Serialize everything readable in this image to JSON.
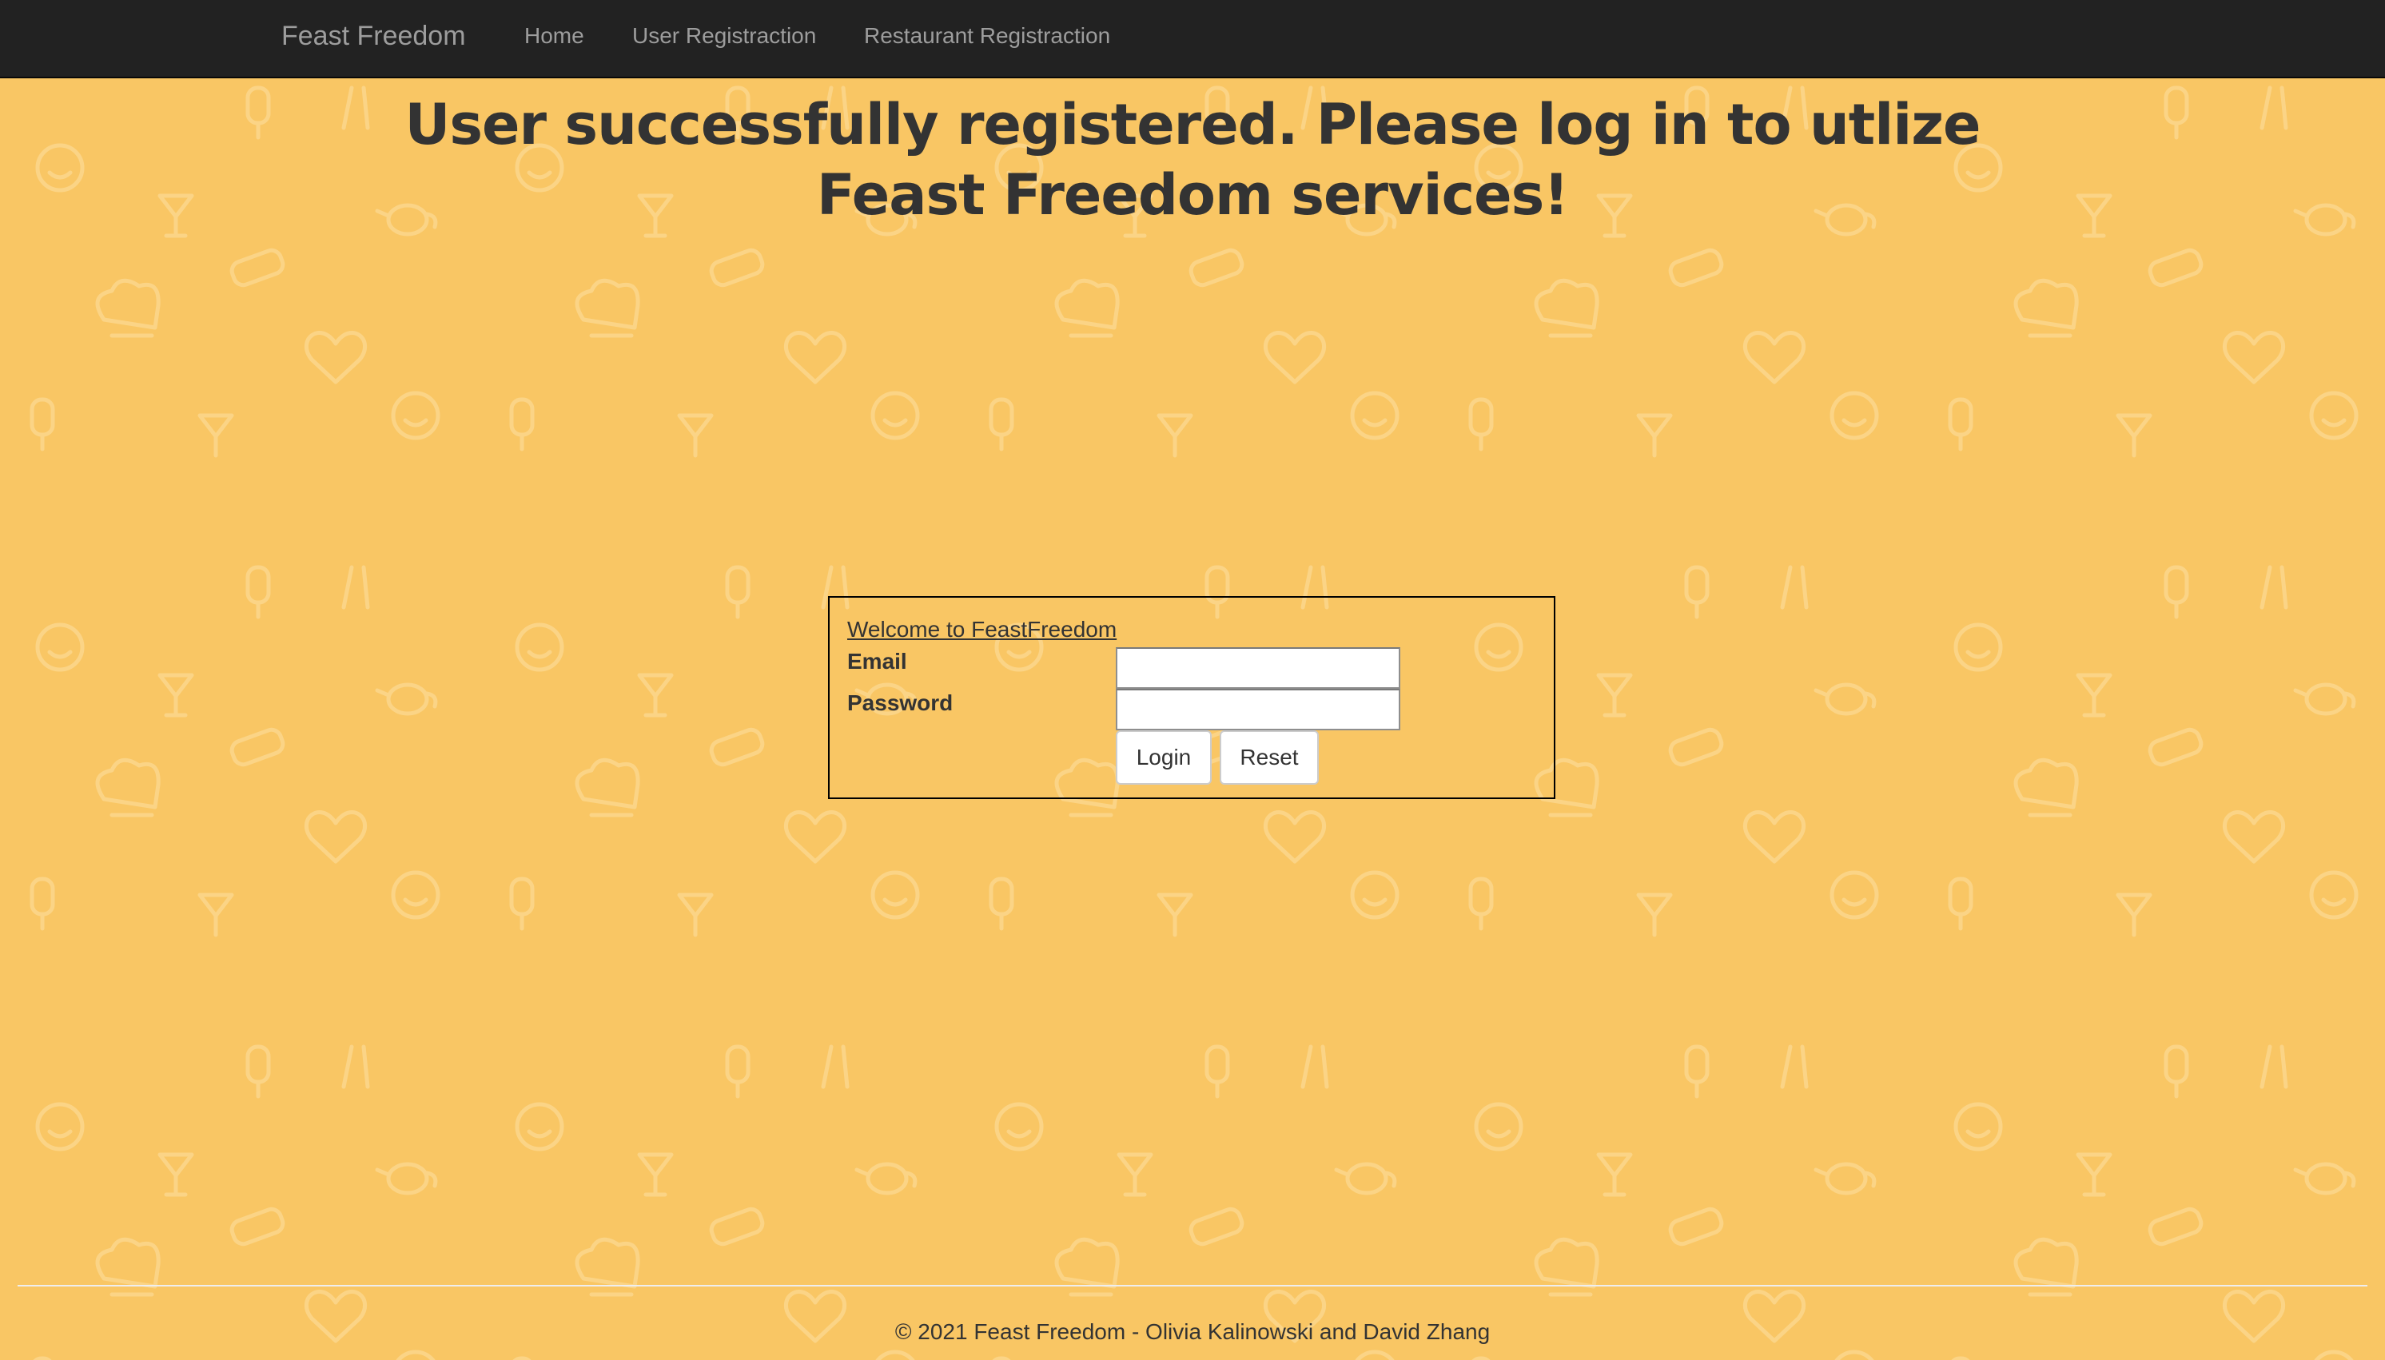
{
  "navbar": {
    "brand": "Feast Freedom",
    "links": [
      {
        "label": "Home"
      },
      {
        "label": "User Registraction"
      },
      {
        "label": "Restaurant Registraction"
      }
    ]
  },
  "main": {
    "heading": "User successfully registered. Please log in to utlize Feast Freedom services!"
  },
  "login": {
    "welcome": "Welcome to FeastFreedom",
    "email_label": "Email",
    "email_value": "",
    "password_label": "Password",
    "password_value": "",
    "login_button": "Login",
    "reset_button": "Reset"
  },
  "footer": {
    "text": "© 2021 Feast Freedom - Olivia Kalinowski and David Zhang"
  },
  "colors": {
    "background": "#f9c664",
    "navbar": "#222222",
    "nav_text": "#9d9d9d",
    "text": "#333333"
  },
  "icons": [
    "popsicle-icon",
    "utensils-icon",
    "smiley-icon",
    "cocktail-icon",
    "teapot-icon",
    "sandwich-icon",
    "chef-hat-icon",
    "heart-icon"
  ]
}
